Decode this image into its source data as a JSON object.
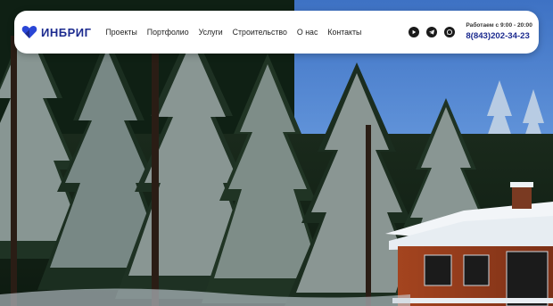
{
  "brand": {
    "name": "ИНБРИГ",
    "logo_color": "#1c2b8f",
    "accent_color": "#2a46d6"
  },
  "nav": {
    "items": [
      {
        "label": "Проекты"
      },
      {
        "label": "Портфолио"
      },
      {
        "label": "Услуги"
      },
      {
        "label": "Строительство"
      },
      {
        "label": "О нас"
      },
      {
        "label": "Контакты"
      }
    ]
  },
  "socials": [
    {
      "icon": "youtube-icon"
    },
    {
      "icon": "telegram-icon"
    },
    {
      "icon": "whatsapp-icon"
    }
  ],
  "contact": {
    "hours": "Работаем с 9:00 - 20:00",
    "phone": "8(843)202-34-23"
  },
  "hero": {
    "scene": "snowy-pine-forest-with-house"
  }
}
